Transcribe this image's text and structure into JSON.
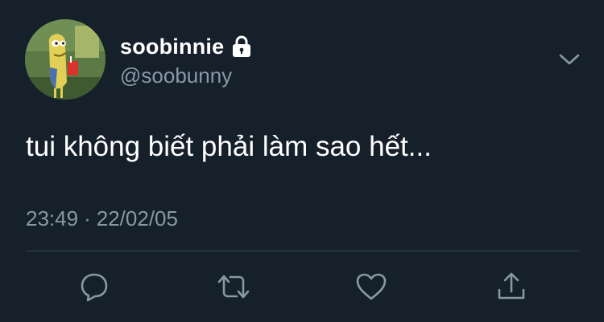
{
  "tweet": {
    "display_name": "soobinnie",
    "handle": "@soobunny",
    "text": "tui không biết phải làm sao hết...",
    "time": "23:49",
    "separator": "·",
    "date": "22/02/05"
  },
  "icons": {
    "lock": "lock-icon",
    "more": "chevron-down-icon",
    "reply": "reply-icon",
    "retweet": "retweet-icon",
    "like": "heart-icon",
    "share": "share-icon"
  },
  "colors": {
    "background": "#15202b",
    "primary_text": "#ffffff",
    "secondary_text": "#8899a6",
    "divider": "#38444d"
  }
}
